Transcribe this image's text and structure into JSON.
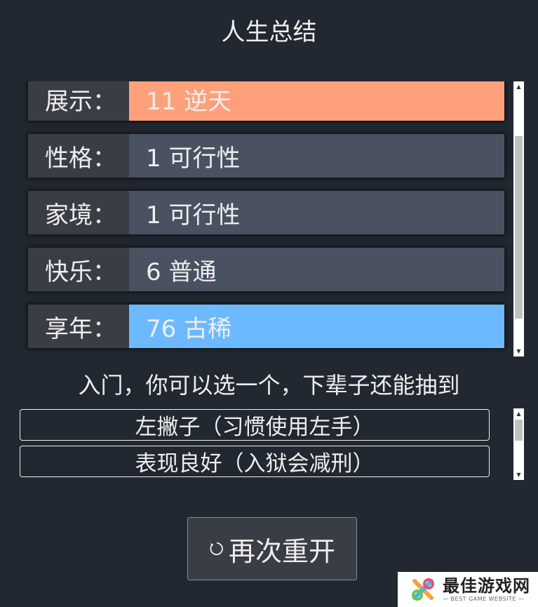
{
  "title": "人生总结",
  "summary": {
    "rows": [
      {
        "label": "展示：",
        "value": "11 逆天",
        "color": "#ffa07a"
      },
      {
        "label": "性格：",
        "value": "1 可行性",
        "color": "#4a5261"
      },
      {
        "label": "家境：",
        "value": "1 可行性",
        "color": "#4a5261"
      },
      {
        "label": "快乐：",
        "value": "6 普通",
        "color": "#4a5261"
      },
      {
        "label": "享年：",
        "value": "76 古稀",
        "color": "#6cb9ff"
      }
    ]
  },
  "hint": "入门，你可以选一个，下辈子还能抽到",
  "talents": [
    "左撇子（习惯使用左手）",
    "表现良好（入狱会减刑）"
  ],
  "restart_label": "再次重开",
  "watermark": {
    "name": "最佳游戏网",
    "tagline": "— BEST GAME WEBSITE —"
  },
  "colors": {
    "background": "#222831",
    "row_bg": "#393e46",
    "value_bg": "#4a5261",
    "highlight_orange": "#ffa07a",
    "highlight_blue": "#6cb9ff"
  },
  "icons": {
    "restart": "restart-icon",
    "scroll_up": "scroll-up-arrow-icon",
    "scroll_down": "scroll-down-arrow-icon"
  }
}
